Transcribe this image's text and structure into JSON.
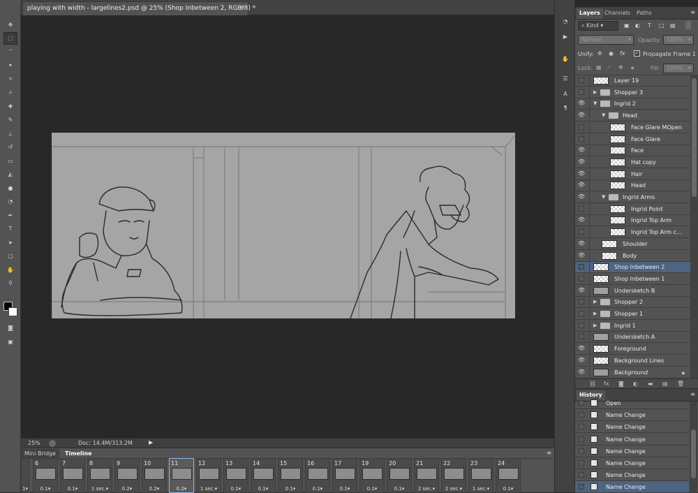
{
  "document": {
    "tab_title": "playing with width - largelines2.psd @ 25% (Shop Inbetween 2, RGB/8) *",
    "close_glyph": "×"
  },
  "tools": [
    "move-icon",
    "marquee-icon",
    "lasso-icon",
    "magic-wand-icon",
    "crop-icon",
    "eyedropper-icon",
    "healing-brush-icon",
    "brush-icon",
    "clone-stamp-icon",
    "history-brush-icon",
    "eraser-icon",
    "paint-bucket-icon",
    "blur-icon",
    "dodge-icon",
    "pen-icon",
    "type-icon",
    "path-selection-icon",
    "shape-icon",
    "hand-icon",
    "zoom-icon"
  ],
  "status": {
    "zoom": "25%",
    "doc_info": "Doc: 14.4M/313.2M",
    "arrow": "▶"
  },
  "bottom_tabs": {
    "mini_bridge": "Mini Bridge",
    "timeline": "Timeline"
  },
  "frames": [
    {
      "num": "6",
      "delay": "0.1▾"
    },
    {
      "num": "7",
      "delay": "0.1▾"
    },
    {
      "num": "8",
      "delay": "1 sec.▾"
    },
    {
      "num": "9",
      "delay": "0.2▾"
    },
    {
      "num": "10",
      "delay": "0.2▾"
    },
    {
      "num": "11",
      "delay": "0.2▾"
    },
    {
      "num": "12",
      "delay": "1 sec.▾"
    },
    {
      "num": "13",
      "delay": "0.1▾"
    },
    {
      "num": "14",
      "delay": "0.1▾"
    },
    {
      "num": "15",
      "delay": "0.1▾"
    },
    {
      "num": "16",
      "delay": "0.1▾"
    },
    {
      "num": "17",
      "delay": "0.1▾"
    },
    {
      "num": "19",
      "delay": "0.1▾"
    },
    {
      "num": "20",
      "delay": "0.1▾"
    },
    {
      "num": "21",
      "delay": "2 sec.▾"
    },
    {
      "num": "22",
      "delay": "2 sec.▾"
    },
    {
      "num": "23",
      "delay": "1 sec.▾"
    },
    {
      "num": "24",
      "delay": "0.1▾"
    }
  ],
  "first_frame_partial_delay": "1▾",
  "layers_panel": {
    "tabs": [
      "Layers",
      "Channels",
      "Paths"
    ],
    "kind_label": "Kind",
    "blend_mode": "Normal",
    "opacity_label": "Opacity:",
    "opacity_value": "100%",
    "unify_label": "Unify:",
    "propagate_label": "Propagate Frame 1",
    "lock_label": "Lock:",
    "fill_label": "Fill:",
    "fill_value": "100%",
    "menu_glyph": "≡"
  },
  "layers": [
    {
      "name": "Layer 19",
      "indent": 0,
      "type": "layer",
      "visible": false
    },
    {
      "name": "Shopper 3",
      "indent": 0,
      "type": "group",
      "visible": false,
      "open": false
    },
    {
      "name": "Ingrid 2",
      "indent": 0,
      "type": "group",
      "visible": true,
      "open": true
    },
    {
      "name": "Head",
      "indent": 1,
      "type": "group",
      "visible": true,
      "open": true
    },
    {
      "name": "Face Glare MOpen",
      "indent": 2,
      "type": "layer",
      "visible": false
    },
    {
      "name": "Face Glare",
      "indent": 2,
      "type": "layer",
      "visible": false
    },
    {
      "name": "Face",
      "indent": 2,
      "type": "layer",
      "visible": true
    },
    {
      "name": "Hat copy",
      "indent": 2,
      "type": "layer",
      "visible": true
    },
    {
      "name": "Hair",
      "indent": 2,
      "type": "layer",
      "visible": true
    },
    {
      "name": "Head",
      "indent": 2,
      "type": "layer",
      "visible": true
    },
    {
      "name": "Ingrid Arms",
      "indent": 1,
      "type": "group",
      "visible": true,
      "open": true
    },
    {
      "name": "Ingrid Point",
      "indent": 2,
      "type": "layer",
      "visible": false
    },
    {
      "name": "Ingrid Top Arm",
      "indent": 2,
      "type": "layer",
      "visible": true
    },
    {
      "name": "Ingrid Top Arm c...",
      "indent": 2,
      "type": "layer",
      "visible": false
    },
    {
      "name": "Shoulder",
      "indent": 1,
      "type": "layer",
      "visible": true
    },
    {
      "name": "Body",
      "indent": 1,
      "type": "layer",
      "visible": true
    },
    {
      "name": "Shop Inbetween 2",
      "indent": 0,
      "type": "layer",
      "visible": false,
      "selected": true
    },
    {
      "name": "Shop Inbetween 1",
      "indent": 0,
      "type": "layer",
      "visible": false
    },
    {
      "name": "Undersketch B",
      "indent": 0,
      "type": "sketch",
      "visible": true
    },
    {
      "name": "Shopper 2",
      "indent": 0,
      "type": "group",
      "visible": false,
      "open": false
    },
    {
      "name": "Shopper 1",
      "indent": 0,
      "type": "group",
      "visible": false,
      "open": false
    },
    {
      "name": "Ingrid 1",
      "indent": 0,
      "type": "group",
      "visible": false,
      "open": false
    },
    {
      "name": "Undersketch A",
      "indent": 0,
      "type": "sketch",
      "visible": false
    },
    {
      "name": "Foreground",
      "indent": 0,
      "type": "layer",
      "visible": true
    },
    {
      "name": "Background Lines",
      "indent": 0,
      "type": "layer",
      "visible": true
    },
    {
      "name": "Background",
      "indent": 0,
      "type": "bg",
      "visible": true,
      "italic": true
    }
  ],
  "layers_footer": [
    "link-icon",
    "fx",
    "mask-icon",
    "adjustment-icon",
    "folder-icon",
    "new-layer-icon",
    "trash-icon"
  ],
  "history_panel": {
    "title": "History",
    "items": [
      {
        "name": "Open"
      },
      {
        "name": "Name Change"
      },
      {
        "name": "Name Change"
      },
      {
        "name": "Name Change"
      },
      {
        "name": "Name Change"
      },
      {
        "name": "Name Change"
      },
      {
        "name": "Name Change"
      },
      {
        "name": "Name Change",
        "selected": true
      }
    ]
  }
}
